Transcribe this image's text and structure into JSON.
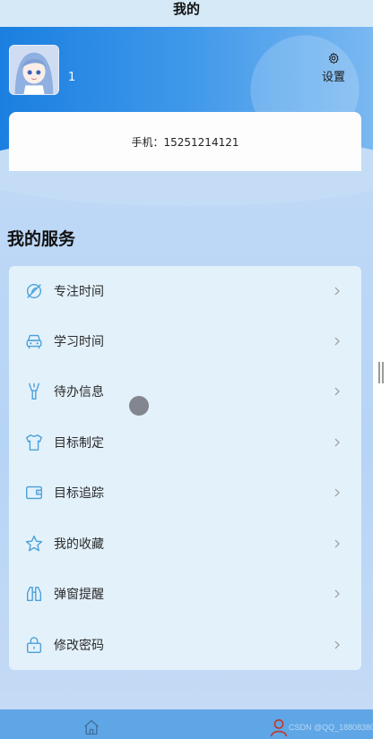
{
  "page": {
    "title": "我的"
  },
  "user": {
    "name": "1",
    "phone_text": "手机：15251214121"
  },
  "settings": {
    "label": "设置",
    "icon": "gear-icon"
  },
  "services": {
    "title": "我的服务",
    "items": [
      {
        "label": "专注时间",
        "icon": "leaf-icon"
      },
      {
        "label": "学习时间",
        "icon": "car-icon"
      },
      {
        "label": "待办信息",
        "icon": "brush-icon"
      },
      {
        "label": "目标制定",
        "icon": "shirt-icon"
      },
      {
        "label": "目标追踪",
        "icon": "wallet-icon"
      },
      {
        "label": "我的收藏",
        "icon": "star-icon"
      },
      {
        "label": "弹窗提醒",
        "icon": "binoculars-icon"
      },
      {
        "label": "修改密码",
        "icon": "lock-icon"
      }
    ]
  },
  "bottom_nav": {
    "items": [
      {
        "icon": "home-icon"
      },
      {
        "icon": "user-icon"
      }
    ]
  },
  "watermark": "CSDN @QQ_188083800",
  "colors": {
    "accent": "#1a7fe0",
    "icon": "#4aa0d8",
    "nav": "#5fa6e6"
  }
}
